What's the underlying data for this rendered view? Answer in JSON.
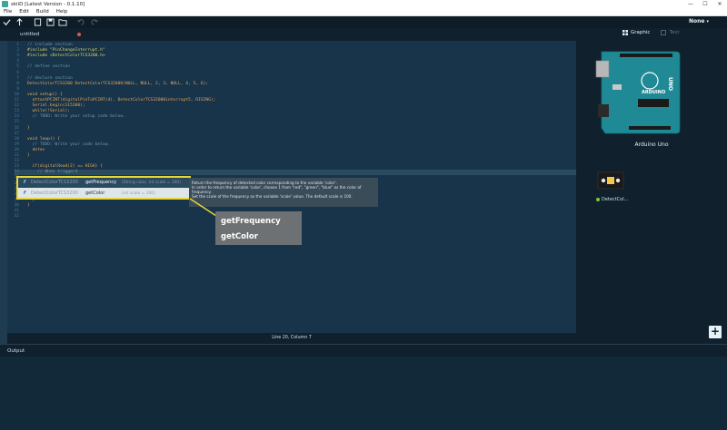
{
  "window": {
    "title": "skiiD [Latest Version - 0.1.10]",
    "controls": [
      "—",
      "☐",
      "✕"
    ]
  },
  "menu": [
    "File",
    "Edit",
    "Build",
    "Help"
  ],
  "toolbar": {
    "board_select": "None"
  },
  "file_tab": {
    "name": "untitled"
  },
  "code_lines": [
    {
      "n": "1",
      "text": "// include section",
      "kind": "comment"
    },
    {
      "n": "2",
      "text": "#include \"PinChangeInterrupt.h\"",
      "kind": "directive"
    },
    {
      "n": "3",
      "text": "#include <DetectColorTCS3200.h>",
      "kind": "directive"
    },
    {
      "n": "4",
      "text": "",
      "kind": "plain"
    },
    {
      "n": "5",
      "text": "// define section",
      "kind": "comment"
    },
    {
      "n": "6",
      "text": "",
      "kind": "plain"
    },
    {
      "n": "7",
      "text": "// declare section",
      "kind": "comment"
    },
    {
      "n": "8",
      "text": "DetectColorTCS3200 DetectColorTCS32000(NULL, NULL, 2, 3, NULL, 4, 5, 6);",
      "kind": "plain"
    },
    {
      "n": "9",
      "text": "",
      "kind": "plain"
    },
    {
      "n": "10",
      "text": "void setup() {",
      "kind": "keyword"
    },
    {
      "n": "11",
      "text": "  attachPCINT(digitalPinToPCINT(4), DetectColorTCS32000interrupt5, RISING);",
      "kind": "plain"
    },
    {
      "n": "12",
      "text": "  Serial.begin(115200);",
      "kind": "plain"
    },
    {
      "n": "13",
      "text": "  while(!Serial);",
      "kind": "plain"
    },
    {
      "n": "14",
      "text": "  // TODO: Write your setup code below.",
      "kind": "comment"
    },
    {
      "n": "15",
      "text": "",
      "kind": "plain"
    },
    {
      "n": "16",
      "text": "}",
      "kind": "plain"
    },
    {
      "n": "17",
      "text": "",
      "kind": "plain"
    },
    {
      "n": "18",
      "text": "void loop() {",
      "kind": "keyword"
    },
    {
      "n": "19",
      "text": "  // TODO: Write your code below.",
      "kind": "comment"
    },
    {
      "n": "20",
      "text": "  detec",
      "kind": "plain"
    },
    {
      "n": "21",
      "text": "}",
      "kind": "plain"
    },
    {
      "n": "22",
      "text": "",
      "kind": "plain"
    },
    {
      "n": "23",
      "text": "  if(digitalRead(2) == HIGH) {",
      "kind": "plain"
    },
    {
      "n": "24",
      "text": "    // When triggerd",
      "kind": "comment"
    },
    {
      "n": "25",
      "text": "",
      "kind": "plain"
    },
    {
      "n": "26",
      "text": "  } else {",
      "kind": "plain"
    },
    {
      "n": "27",
      "text": "    // When released",
      "kind": "comment"
    },
    {
      "n": "28",
      "text": "",
      "kind": "plain"
    },
    {
      "n": "29",
      "text": "  }",
      "kind": "plain"
    },
    {
      "n": "30",
      "text": "}",
      "kind": "plain"
    },
    {
      "n": "31",
      "text": "",
      "kind": "plain"
    },
    {
      "n": "32",
      "text": "",
      "kind": "plain"
    }
  ],
  "autocomplete": [
    {
      "icon": "f",
      "class": "DetectColorTCS3200",
      "method": "getFrequency",
      "signature": "(String color, int scale = 100)"
    },
    {
      "icon": "f",
      "class": "DetectColorTCS3200",
      "method": "getColor",
      "signature": "(int scale = 100)"
    }
  ],
  "doc_tooltip": [
    "Return the frequency of detected color corresponding to the variable 'color'.",
    "In order to return the variable 'color', choose 1 from \"red\", \"green\", \"blue\" as the color of frequency.",
    "Set the scale of the frequency as the variable 'scale' value. The default scale is 100."
  ],
  "callout": [
    "getFrequency",
    "getColor"
  ],
  "status_line": "Line 20, Column 7",
  "output": {
    "title": "Output"
  },
  "right_panel": {
    "tabs": [
      "Graphic",
      "Text"
    ],
    "board_name": "Arduino Uno",
    "board_silk": {
      "uno": "UNO",
      "brand": "ARDUINO"
    },
    "module_label": "DetectCol...",
    "add_symbol": "+"
  },
  "colors": {
    "highlight": "#e8d634",
    "board_teal": "#1f8a96",
    "status_green": "#7fc63d"
  }
}
